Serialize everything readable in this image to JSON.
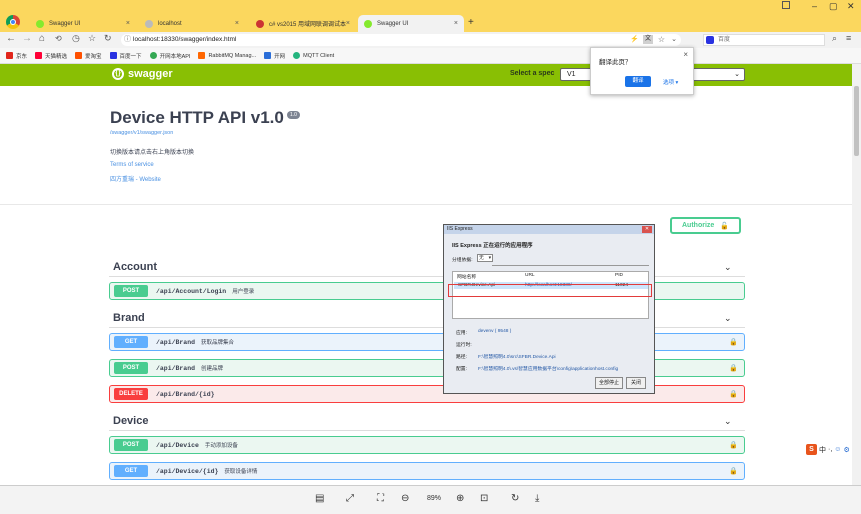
{
  "browser": {
    "tabs": [
      {
        "label": "Swagger UI",
        "color": "#85ea2d"
      },
      {
        "label": "localhost",
        "color": "#aaaaaa"
      },
      {
        "label": "c# vs2015 用域网联调调试本地项目...",
        "color": "#cc3333"
      },
      {
        "label": "Swagger UI",
        "color": "#85ea2d"
      }
    ],
    "new_tab": "+",
    "url": "localhost:18330/swagger/index.html",
    "search_placeholder": "百度",
    "win_min": "–",
    "win_max": "▢",
    "win_close": "✕"
  },
  "bookmarks": [
    {
      "label": "京东",
      "color": "#e1251b"
    },
    {
      "label": "天猫精选",
      "color": "#ff0036"
    },
    {
      "label": "爱淘宝",
      "color": "#ff5000"
    },
    {
      "label": "百度一下",
      "color": "#2932e1"
    },
    {
      "label": "开网本地API",
      "color": "#34a853"
    },
    {
      "label": "RabbitMQ Manag...",
      "color": "#ff6600"
    },
    {
      "label": "开网",
      "color": "#2b6ed8"
    },
    {
      "label": "MQTT Client",
      "color": "#24b47e"
    }
  ],
  "translate_popup": {
    "title": "翻译此页？",
    "translate": "翻译",
    "options": "选项 ▾",
    "close": "×"
  },
  "swagger": {
    "brand": "swagger",
    "spec_label": "Select a spec",
    "spec_value": "V1",
    "title": "Device HTTP API v1.0",
    "version": "1.0",
    "json_link": "/swagger/v1/swagger.json",
    "description": "切换版本请点击右上角版本切换",
    "terms": "Terms of service",
    "website": "四方重瑞 - Website",
    "authorize": "Authorize",
    "sections": [
      {
        "name": "Account",
        "ops": [
          {
            "method": "POST",
            "path": "/api/Account/Login",
            "desc": "用户登录"
          }
        ]
      },
      {
        "name": "Brand",
        "ops": [
          {
            "method": "GET",
            "path": "/api/Brand",
            "desc": "获取品牌集合"
          },
          {
            "method": "POST",
            "path": "/api/Brand",
            "desc": "创建品牌"
          },
          {
            "method": "DELETE",
            "path": "/api/Brand/{id}",
            "desc": ""
          }
        ]
      },
      {
        "name": "Device",
        "ops": [
          {
            "method": "POST",
            "path": "/api/Device",
            "desc": "手动添加设备"
          },
          {
            "method": "GET",
            "path": "/api/Device/{id}",
            "desc": "获取设备详情"
          }
        ]
      }
    ]
  },
  "iis": {
    "title": "IIS Express",
    "heading": "IIS Express 正在运行的应用程序",
    "filter_label": "分组依据:",
    "filter_value": "无",
    "col_site": "网站名称",
    "col_url": "URL",
    "col_pid": "PID",
    "row_site": "SFBR.Device.Api",
    "row_url": "http://localhost:18330/",
    "row_pid": "11024",
    "app_label": "应用:",
    "app_value": "devenv ( 9548 )",
    "run_label": "运行时:",
    "run_value": "",
    "path_label": "路径:",
    "path_value": "F:\\智慧照明4.0\\src\\SFBR.Device.Api",
    "config_label": "配置:",
    "config_value": "F:\\智慧照明4.0\\.vs\\智慧应用数据平台\\config\\applicationhost.config",
    "stop_all": "全部停止",
    "close": "关闭"
  },
  "viewer": {
    "zoom": "89%"
  },
  "ime": {
    "label": "中",
    "sym": "·,"
  }
}
